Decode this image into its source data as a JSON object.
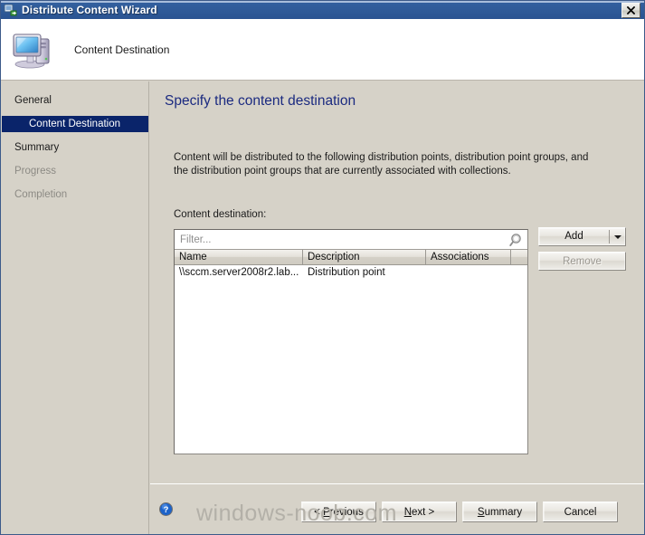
{
  "window": {
    "title": "Distribute Content Wizard",
    "title_icon": "distribute-content-icon",
    "close_label": "✕"
  },
  "header": {
    "icon": "computer-icon",
    "title": "Content Destination"
  },
  "sidebar": {
    "items": [
      {
        "label": "General",
        "state": "normal",
        "indent": false
      },
      {
        "label": "Content Destination",
        "state": "selected",
        "indent": true
      },
      {
        "label": "Summary",
        "state": "normal",
        "indent": false
      },
      {
        "label": "Progress",
        "state": "disabled",
        "indent": false
      },
      {
        "label": "Completion",
        "state": "disabled",
        "indent": false
      }
    ]
  },
  "main": {
    "heading": "Specify the content destination",
    "description": "Content will be distributed to the following distribution points, distribution point groups, and the distribution point groups that are currently associated with collections.",
    "dest_label": "Content destination:",
    "filter": {
      "value": "",
      "placeholder": "Filter...",
      "icon": "search-icon"
    },
    "table": {
      "columns": [
        "Name",
        "Description",
        "Associations",
        ""
      ],
      "rows": [
        {
          "name": "\\\\sccm.server2008r2.lab...",
          "description": "Distribution point",
          "associations": ""
        }
      ]
    },
    "buttons": {
      "add": {
        "label": "Add",
        "enabled": true,
        "has_dropdown": true
      },
      "remove": {
        "label": "Remove",
        "enabled": false
      }
    }
  },
  "footer": {
    "help_icon": "help-question-icon",
    "previous": {
      "pre": "< ",
      "key": "P",
      "post": "revious"
    },
    "next": {
      "pre": "",
      "key": "N",
      "post": "ext >"
    },
    "summary": {
      "pre": "",
      "key": "S",
      "post": "ummary"
    },
    "cancel": {
      "label": "Cancel"
    }
  },
  "watermark": {
    "text": "windows-noob.com"
  },
  "colors": {
    "titlebar": "#2f5a98",
    "body": "#d6d2c8",
    "heading": "#1b2a80",
    "selection": "#0a246a",
    "disabled_text": "#8c8a84",
    "watermark": "#b3b0a8"
  }
}
